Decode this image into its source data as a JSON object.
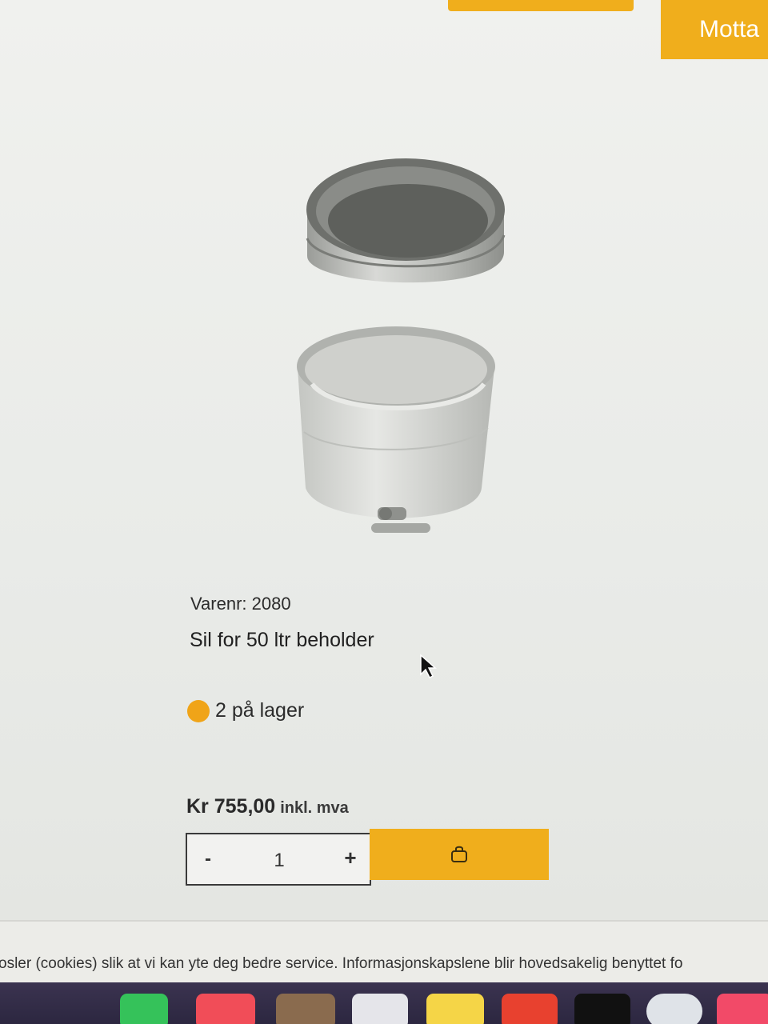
{
  "header": {
    "accept_button_label": "Motta"
  },
  "product": {
    "sku_text": "Varenr: 2080",
    "title": "Sil for 50 ltr beholder",
    "stock_text": "2 på lager",
    "stock_color": "#f0a418",
    "price": "Kr 755,00",
    "price_suffix": "inkl. mva"
  },
  "quantity": {
    "minus_label": "-",
    "value": "1",
    "plus_label": "+"
  },
  "cart": {
    "icon": "shopping-bag-icon",
    "button_color": "#f0ae1c"
  },
  "cookie_notice": {
    "text": "osler (cookies) slik at vi kan yte deg bedre service. Informasjonskapslene blir hovedsakelig benyttet fo"
  },
  "dock": {
    "apps": [
      "messages",
      "calendar",
      "finder",
      "music-app",
      "notes",
      "yellow-app",
      "red-app",
      "apple-tv",
      "chrome",
      "itunes"
    ]
  }
}
